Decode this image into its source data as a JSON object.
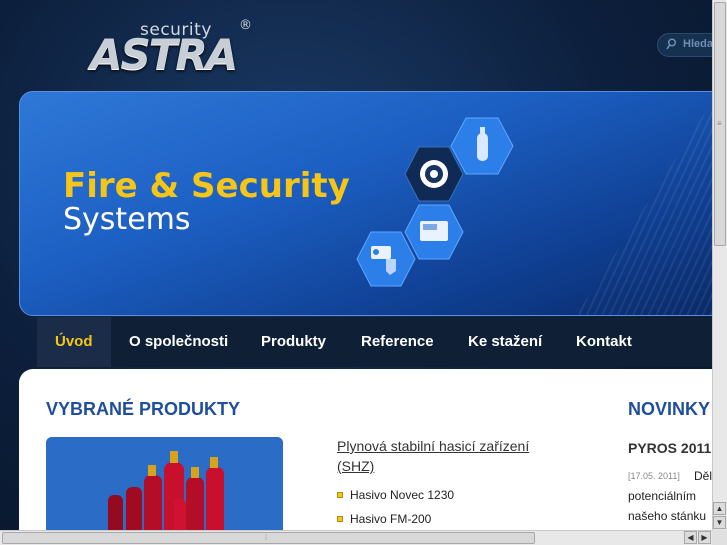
{
  "header": {
    "logo_small": "security",
    "logo_main": "ASTRA",
    "logo_reg": "®",
    "search_placeholder": "Hledat"
  },
  "banner": {
    "title_line1": "Fire & Security",
    "title_line2": "Systems"
  },
  "nav": {
    "items": [
      {
        "label": "Úvod",
        "active": true
      },
      {
        "label": "O společnosti"
      },
      {
        "label": "Produkty"
      },
      {
        "label": "Reference"
      },
      {
        "label": "Ke stažení"
      },
      {
        "label": "Kontakt"
      }
    ]
  },
  "products": {
    "heading": "VYBRANÉ PRODUKTY",
    "link": "Plynová stabilní hasicí zařízení (SHZ)",
    "list": [
      "Hasivo Novec 1230",
      "Hasivo FM-200"
    ]
  },
  "news": {
    "heading": "NOVINKY",
    "title": "PYROS 2011",
    "date": "[17.05. 2011]",
    "text1": "Děl",
    "text2": "potenciálním",
    "text3": "našeho stánku"
  },
  "colors": {
    "accent_yellow": "#f5c518",
    "heading_blue": "#1f4f9c",
    "nav_bg": "#0f1f36"
  }
}
